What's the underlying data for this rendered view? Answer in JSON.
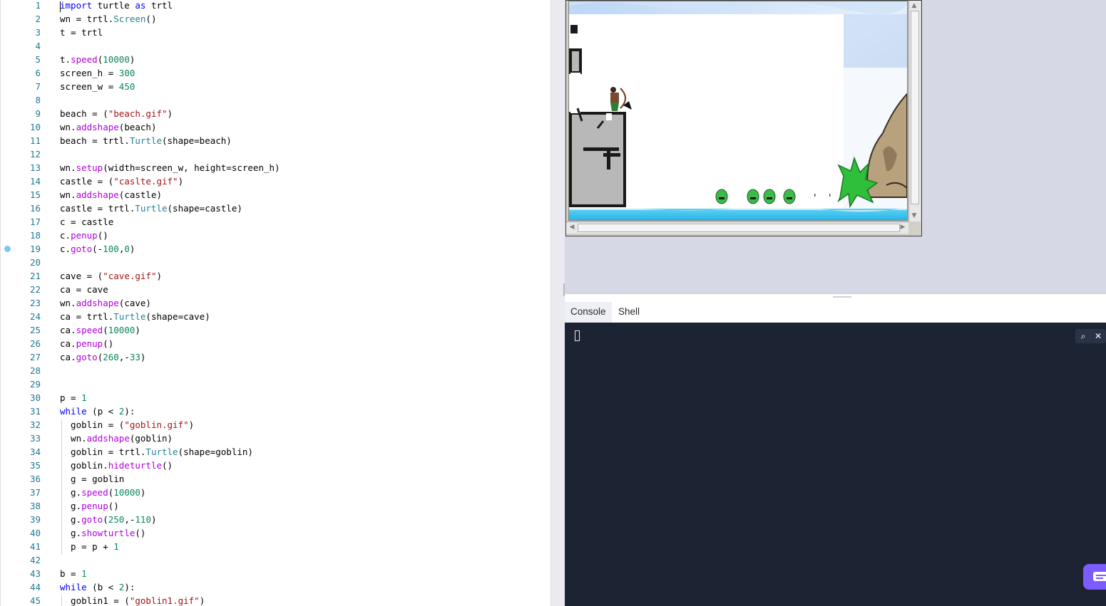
{
  "editor": {
    "breakpoint_line": 19,
    "lines": [
      {
        "n": "1",
        "t": [
          [
            "kw",
            "import"
          ],
          [
            "op",
            " turtle "
          ],
          [
            "kw",
            "as"
          ],
          [
            "op",
            " trtl"
          ]
        ]
      },
      {
        "n": "2",
        "t": [
          [
            "op",
            "wn = trtl."
          ],
          [
            "cls",
            "Screen"
          ],
          [
            "op",
            "()"
          ]
        ]
      },
      {
        "n": "3",
        "t": [
          [
            "op",
            "t = trtl"
          ]
        ]
      },
      {
        "n": "4",
        "t": []
      },
      {
        "n": "5",
        "t": [
          [
            "op",
            "t."
          ],
          [
            "mth",
            "speed"
          ],
          [
            "op",
            "("
          ],
          [
            "num",
            "10000"
          ],
          [
            "op",
            ")"
          ]
        ]
      },
      {
        "n": "6",
        "t": [
          [
            "op",
            "screen_h = "
          ],
          [
            "num",
            "300"
          ]
        ]
      },
      {
        "n": "7",
        "t": [
          [
            "op",
            "screen_w = "
          ],
          [
            "num",
            "450"
          ]
        ]
      },
      {
        "n": "8",
        "t": []
      },
      {
        "n": "9",
        "t": [
          [
            "op",
            "beach = ("
          ],
          [
            "str",
            "\"beach.gif\""
          ],
          [
            "op",
            ")"
          ]
        ]
      },
      {
        "n": "10",
        "t": [
          [
            "op",
            "wn."
          ],
          [
            "mth",
            "addshape"
          ],
          [
            "op",
            "(beach)"
          ]
        ]
      },
      {
        "n": "11",
        "t": [
          [
            "op",
            "beach = trtl."
          ],
          [
            "cls",
            "Turtle"
          ],
          [
            "op",
            "(shape=beach)"
          ]
        ]
      },
      {
        "n": "12",
        "t": []
      },
      {
        "n": "13",
        "t": [
          [
            "op",
            "wn."
          ],
          [
            "mth",
            "setup"
          ],
          [
            "op",
            "(width=screen_w, height=screen_h)"
          ]
        ]
      },
      {
        "n": "14",
        "t": [
          [
            "op",
            "castle = ("
          ],
          [
            "str",
            "\"caslte.gif\""
          ],
          [
            "op",
            ")"
          ]
        ]
      },
      {
        "n": "15",
        "t": [
          [
            "op",
            "wn."
          ],
          [
            "mth",
            "addshape"
          ],
          [
            "op",
            "(castle)"
          ]
        ]
      },
      {
        "n": "16",
        "t": [
          [
            "op",
            "castle = trtl."
          ],
          [
            "cls",
            "Turtle"
          ],
          [
            "op",
            "(shape=castle)"
          ]
        ]
      },
      {
        "n": "17",
        "t": [
          [
            "op",
            "c = castle"
          ]
        ]
      },
      {
        "n": "18",
        "t": [
          [
            "op",
            "c."
          ],
          [
            "mth",
            "penup"
          ],
          [
            "op",
            "()"
          ]
        ]
      },
      {
        "n": "19",
        "t": [
          [
            "op",
            "c."
          ],
          [
            "mth",
            "goto"
          ],
          [
            "op",
            "(-"
          ],
          [
            "num",
            "100"
          ],
          [
            "op",
            ","
          ],
          [
            "num",
            "0"
          ],
          [
            "op",
            ")"
          ]
        ]
      },
      {
        "n": "20",
        "t": []
      },
      {
        "n": "21",
        "t": [
          [
            "op",
            "cave = ("
          ],
          [
            "str",
            "\"cave.gif\""
          ],
          [
            "op",
            ")"
          ]
        ]
      },
      {
        "n": "22",
        "t": [
          [
            "op",
            "ca = cave"
          ]
        ]
      },
      {
        "n": "23",
        "t": [
          [
            "op",
            "wn."
          ],
          [
            "mth",
            "addshape"
          ],
          [
            "op",
            "(cave)"
          ]
        ]
      },
      {
        "n": "24",
        "t": [
          [
            "op",
            "ca = trtl."
          ],
          [
            "cls",
            "Turtle"
          ],
          [
            "op",
            "(shape=cave)"
          ]
        ]
      },
      {
        "n": "25",
        "t": [
          [
            "op",
            "ca."
          ],
          [
            "mth",
            "speed"
          ],
          [
            "op",
            "("
          ],
          [
            "num",
            "10000"
          ],
          [
            "op",
            ")"
          ]
        ]
      },
      {
        "n": "26",
        "t": [
          [
            "op",
            "ca."
          ],
          [
            "mth",
            "penup"
          ],
          [
            "op",
            "()"
          ]
        ]
      },
      {
        "n": "27",
        "t": [
          [
            "op",
            "ca."
          ],
          [
            "mth",
            "goto"
          ],
          [
            "op",
            "("
          ],
          [
            "num",
            "260"
          ],
          [
            "op",
            ",-"
          ],
          [
            "num",
            "33"
          ],
          [
            "op",
            ")"
          ]
        ]
      },
      {
        "n": "28",
        "t": []
      },
      {
        "n": "29",
        "t": []
      },
      {
        "n": "30",
        "t": [
          [
            "op",
            "p = "
          ],
          [
            "num",
            "1"
          ]
        ]
      },
      {
        "n": "31",
        "t": [
          [
            "kw",
            "while"
          ],
          [
            "op",
            " (p < "
          ],
          [
            "num",
            "2"
          ],
          [
            "op",
            "):"
          ]
        ]
      },
      {
        "n": "32",
        "t": [
          [
            "op",
            "  goblin = ("
          ],
          [
            "str",
            "\"goblin.gif\""
          ],
          [
            "op",
            ")"
          ]
        ]
      },
      {
        "n": "33",
        "t": [
          [
            "op",
            "  wn."
          ],
          [
            "mth",
            "addshape"
          ],
          [
            "op",
            "(goblin)"
          ]
        ]
      },
      {
        "n": "34",
        "t": [
          [
            "op",
            "  goblin = trtl."
          ],
          [
            "cls",
            "Turtle"
          ],
          [
            "op",
            "(shape=goblin)"
          ]
        ]
      },
      {
        "n": "35",
        "t": [
          [
            "op",
            "  goblin."
          ],
          [
            "mth",
            "hideturtle"
          ],
          [
            "op",
            "()"
          ]
        ]
      },
      {
        "n": "36",
        "t": [
          [
            "op",
            "  g = goblin"
          ]
        ]
      },
      {
        "n": "37",
        "t": [
          [
            "op",
            "  g."
          ],
          [
            "mth",
            "speed"
          ],
          [
            "op",
            "("
          ],
          [
            "num",
            "10000"
          ],
          [
            "op",
            ")"
          ]
        ]
      },
      {
        "n": "38",
        "t": [
          [
            "op",
            "  g."
          ],
          [
            "mth",
            "penup"
          ],
          [
            "op",
            "()"
          ]
        ]
      },
      {
        "n": "39",
        "t": [
          [
            "op",
            "  g."
          ],
          [
            "mth",
            "goto"
          ],
          [
            "op",
            "("
          ],
          [
            "num",
            "250"
          ],
          [
            "op",
            ",-"
          ],
          [
            "num",
            "110"
          ],
          [
            "op",
            ")"
          ]
        ]
      },
      {
        "n": "40",
        "t": [
          [
            "op",
            "  g."
          ],
          [
            "mth",
            "showturtle"
          ],
          [
            "op",
            "()"
          ]
        ]
      },
      {
        "n": "41",
        "t": [
          [
            "op",
            "  p = p + "
          ],
          [
            "num",
            "1"
          ]
        ]
      },
      {
        "n": "42",
        "t": []
      },
      {
        "n": "43",
        "t": [
          [
            "op",
            "b = "
          ],
          [
            "num",
            "1"
          ]
        ]
      },
      {
        "n": "44",
        "t": [
          [
            "kw",
            "while"
          ],
          [
            "op",
            " (b < "
          ],
          [
            "num",
            "2"
          ],
          [
            "op",
            "):"
          ]
        ]
      },
      {
        "n": "45",
        "t": [
          [
            "op",
            "  goblin1 = ("
          ],
          [
            "str",
            "\"goblin1.gif\""
          ],
          [
            "op",
            ")"
          ]
        ]
      }
    ]
  },
  "output_tabs": {
    "console": "Console",
    "shell": "Shell"
  },
  "console": {
    "search_icon": "⌕",
    "close_icon": "✕"
  },
  "colors": {
    "console_bg": "#1c2333",
    "accent": "#7b5cff"
  }
}
